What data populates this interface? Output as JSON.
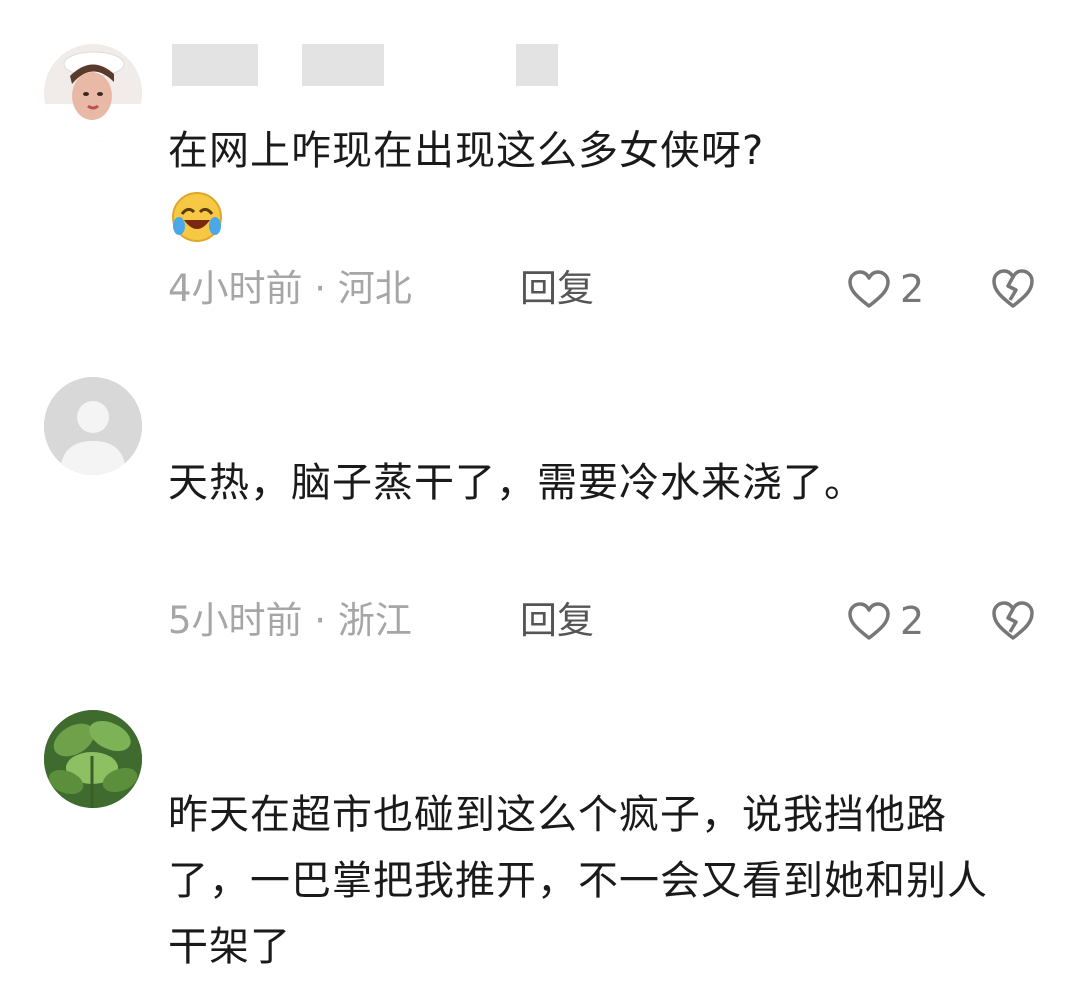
{
  "comments": [
    {
      "avatar": "user-photo-avatar",
      "text": "在网上咋现在出现这么多女侠呀?",
      "emoji": "laughing-crying-emoji",
      "time_location": "4小时前 · 河北",
      "reply_label": "回复",
      "likes": "2"
    },
    {
      "avatar": "default-avatar",
      "text": "天热，脑子蒸干了，需要冷水来浇了。",
      "time_location": "5小时前 · 浙江",
      "reply_label": "回复",
      "likes": "2"
    },
    {
      "avatar": "plant-photo-avatar",
      "text": "昨天在超市也碰到这么个疯子，说我挡他路了，一巴掌把我推开，不一会又看到她和别人干架了"
    }
  ],
  "icons": {
    "like": "heart-outline-icon",
    "dislike": "broken-heart-icon"
  },
  "colors": {
    "text": "#1a1a1a",
    "meta": "#a6a6a6",
    "reply": "#555555"
  }
}
